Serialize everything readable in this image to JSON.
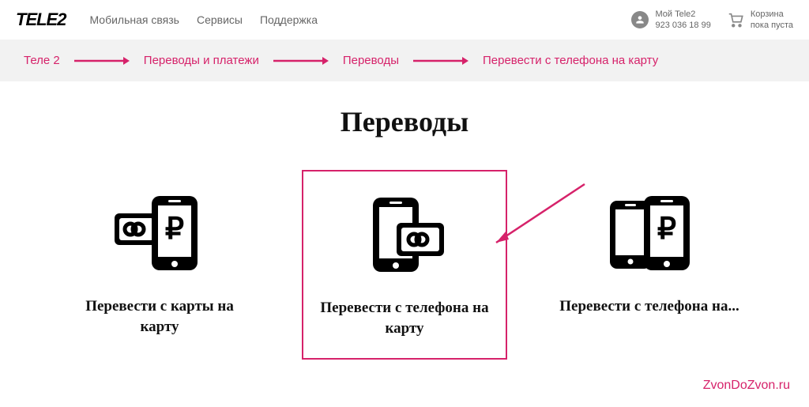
{
  "header": {
    "logo": "TELE2",
    "nav": [
      "Мобильная связь",
      "Сервисы",
      "Поддержка"
    ],
    "account": {
      "title": "Мой Tele2",
      "phone": "923 036 18 99"
    },
    "cart": {
      "title": "Корзина",
      "status": "пока пуста"
    }
  },
  "breadcrumb": {
    "items": [
      "Теле 2",
      "Переводы и платежи",
      "Переводы",
      "Перевести с телефона на карту"
    ]
  },
  "page": {
    "title": "Переводы",
    "tiles": [
      {
        "label": "Перевести с карты на карту"
      },
      {
        "label": "Перевести с телефона на карту"
      },
      {
        "label": "Перевести с телефона на..."
      }
    ]
  },
  "watermark": "ZvonDoZvon.ru",
  "colors": {
    "accent": "#d6226a"
  }
}
